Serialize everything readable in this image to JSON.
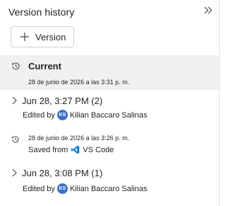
{
  "header": {
    "title": "Version history"
  },
  "toolbar": {
    "add_version_label": "Version"
  },
  "current": {
    "title": "Current",
    "date": "28 de junio de 2026 a las 3:31 p. m."
  },
  "groups": [
    {
      "title": "Jun 28, 3:27 PM (2)",
      "edited_prefix": "Edited by",
      "author_initials": "KS",
      "author_name": "Kilian Baccaro Salinas"
    },
    {
      "title": "Jun 28, 3:08 PM (1)",
      "edited_prefix": "Edited by",
      "author_initials": "KS",
      "author_name": "Kilian Baccaro Salinas"
    }
  ],
  "entry": {
    "date": "28 de junio de 2026 a las 3:26 p. m.",
    "saved_prefix": "Saved from",
    "app_name": "VS Code"
  },
  "colors": {
    "avatar": "#3c70c9",
    "vscode": "#0078d4",
    "current_bg": "#f0f0f0"
  }
}
